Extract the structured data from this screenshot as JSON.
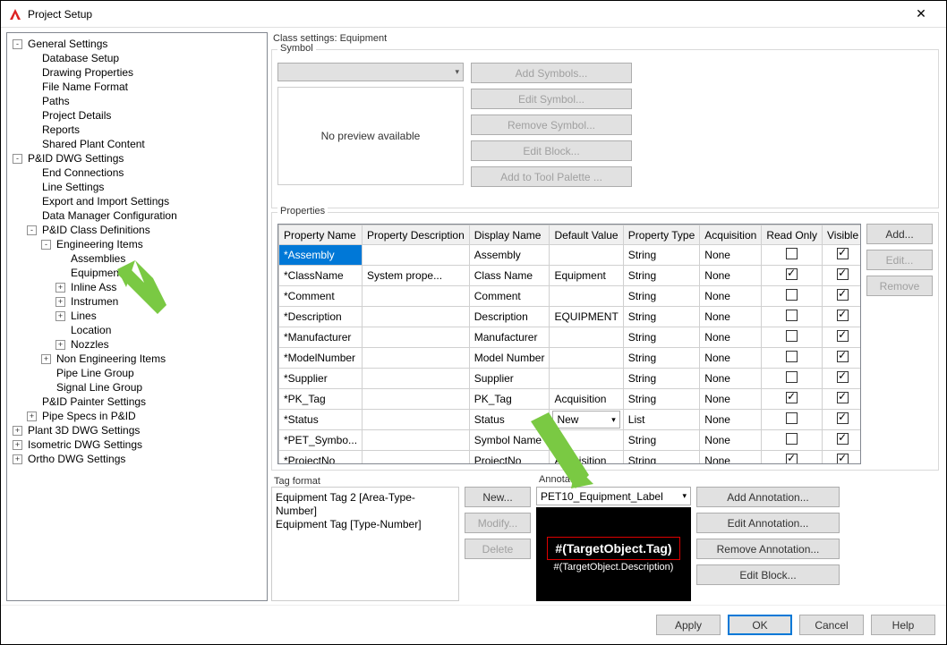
{
  "title": "Project Setup",
  "tree": [
    {
      "lvl": 0,
      "tog": "-",
      "label": "General Settings"
    },
    {
      "lvl": 1,
      "tog": "",
      "label": "Database Setup"
    },
    {
      "lvl": 1,
      "tog": "",
      "label": "Drawing Properties"
    },
    {
      "lvl": 1,
      "tog": "",
      "label": "File Name Format"
    },
    {
      "lvl": 1,
      "tog": "",
      "label": "Paths"
    },
    {
      "lvl": 1,
      "tog": "",
      "label": "Project Details"
    },
    {
      "lvl": 1,
      "tog": "",
      "label": "Reports"
    },
    {
      "lvl": 1,
      "tog": "",
      "label": "Shared Plant Content"
    },
    {
      "lvl": 0,
      "tog": "-",
      "label": "P&ID DWG Settings"
    },
    {
      "lvl": 1,
      "tog": "",
      "label": "End Connections"
    },
    {
      "lvl": 1,
      "tog": "",
      "label": "Line Settings"
    },
    {
      "lvl": 1,
      "tog": "",
      "label": "Export and Import Settings"
    },
    {
      "lvl": 1,
      "tog": "",
      "label": "Data Manager Configuration"
    },
    {
      "lvl": 1,
      "tog": "-",
      "label": "P&ID Class Definitions"
    },
    {
      "lvl": 2,
      "tog": "-",
      "label": "Engineering Items"
    },
    {
      "lvl": 3,
      "tog": "",
      "label": "Assemblies"
    },
    {
      "lvl": 3,
      "tog": "",
      "label": "Equipment",
      "sel": true
    },
    {
      "lvl": 3,
      "tog": "+",
      "label": "Inline Ass"
    },
    {
      "lvl": 3,
      "tog": "+",
      "label": "Instrumen"
    },
    {
      "lvl": 3,
      "tog": "+",
      "label": "Lines"
    },
    {
      "lvl": 3,
      "tog": "",
      "label": "Location"
    },
    {
      "lvl": 3,
      "tog": "+",
      "label": "Nozzles"
    },
    {
      "lvl": 2,
      "tog": "+",
      "label": "Non Engineering Items"
    },
    {
      "lvl": 2,
      "tog": "",
      "label": "Pipe Line Group"
    },
    {
      "lvl": 2,
      "tog": "",
      "label": "Signal Line Group"
    },
    {
      "lvl": 1,
      "tog": "",
      "label": "P&ID Painter Settings"
    },
    {
      "lvl": 1,
      "tog": "+",
      "label": "Pipe Specs in P&ID"
    },
    {
      "lvl": 0,
      "tog": "+",
      "label": "Plant 3D DWG Settings"
    },
    {
      "lvl": 0,
      "tog": "+",
      "label": "Isometric DWG Settings"
    },
    {
      "lvl": 0,
      "tog": "+",
      "label": "Ortho DWG Settings"
    }
  ],
  "class_line": "Class settings: Equipment",
  "symbol": {
    "title": "Symbol",
    "preview_text": "No preview available",
    "buttons": [
      "Add Symbols...",
      "Edit Symbol...",
      "Remove Symbol...",
      "Edit Block...",
      "Add to Tool Palette ..."
    ]
  },
  "properties_title": "Properties",
  "grid": {
    "headers": [
      "Property Name",
      "Property Description",
      "Display Name",
      "Default Value",
      "Property Type",
      "Acquisition",
      "Read Only",
      "Visible"
    ],
    "rows": [
      {
        "name": "*Assembly",
        "desc": "",
        "disp": "Assembly",
        "def": "",
        "type": "String",
        "acq": "None",
        "ro": false,
        "vis": true,
        "sel": true
      },
      {
        "name": "*ClassName",
        "desc": "System prope...",
        "disp": "Class Name",
        "def": "Equipment",
        "type": "String",
        "acq": "None",
        "ro": true,
        "vis": true
      },
      {
        "name": "*Comment",
        "desc": "",
        "disp": "Comment",
        "def": "",
        "type": "String",
        "acq": "None",
        "ro": false,
        "vis": true
      },
      {
        "name": "*Description",
        "desc": "",
        "disp": "Description",
        "def": "EQUIPMENT",
        "type": "String",
        "acq": "None",
        "ro": false,
        "vis": true
      },
      {
        "name": "*Manufacturer",
        "desc": "",
        "disp": "Manufacturer",
        "def": "",
        "type": "String",
        "acq": "None",
        "ro": false,
        "vis": true
      },
      {
        "name": "*ModelNumber",
        "desc": "",
        "disp": "Model Number",
        "def": "",
        "type": "String",
        "acq": "None",
        "ro": false,
        "vis": true
      },
      {
        "name": "*Supplier",
        "desc": "",
        "disp": "Supplier",
        "def": "",
        "type": "String",
        "acq": "None",
        "ro": false,
        "vis": true
      },
      {
        "name": "*PK_Tag",
        "desc": "",
        "disp": "PK_Tag",
        "def": "Acquisition",
        "type": "String",
        "acq": "None",
        "ro": true,
        "vis": true
      },
      {
        "name": "*Status",
        "desc": "",
        "disp": "Status",
        "def": "New",
        "type": "List",
        "acq": "None",
        "ro": false,
        "vis": true,
        "combo": true
      },
      {
        "name": "*PET_Symbo...",
        "desc": "",
        "disp": "Symbol Name",
        "def": "",
        "type": "String",
        "acq": "None",
        "ro": false,
        "vis": true
      },
      {
        "name": "*ProjectNo",
        "desc": "",
        "disp": "ProjectNo",
        "def": "Acquisition",
        "type": "String",
        "acq": "None",
        "ro": true,
        "vis": true
      }
    ],
    "buttons": {
      "add": "Add...",
      "edit": "Edit...",
      "remove": "Remove"
    }
  },
  "tagformat": {
    "title": "Tag format",
    "lines": [
      "Equipment Tag 2 [Area-Type-Number]",
      "Equipment Tag [Type-Number]"
    ],
    "buttons": {
      "new": "New...",
      "modify": "Modify...",
      "delete": "Delete"
    }
  },
  "annotation": {
    "title": "Annotation",
    "selected": "PET10_Equipment_Label",
    "preview_main": "#(TargetObject.Tag)",
    "preview_sub": "#(TargetObject.Description)",
    "buttons": [
      "Add Annotation...",
      "Edit Annotation...",
      "Remove Annotation...",
      "Edit Block..."
    ]
  },
  "footer": {
    "apply": "Apply",
    "ok": "OK",
    "cancel": "Cancel",
    "help": "Help"
  }
}
